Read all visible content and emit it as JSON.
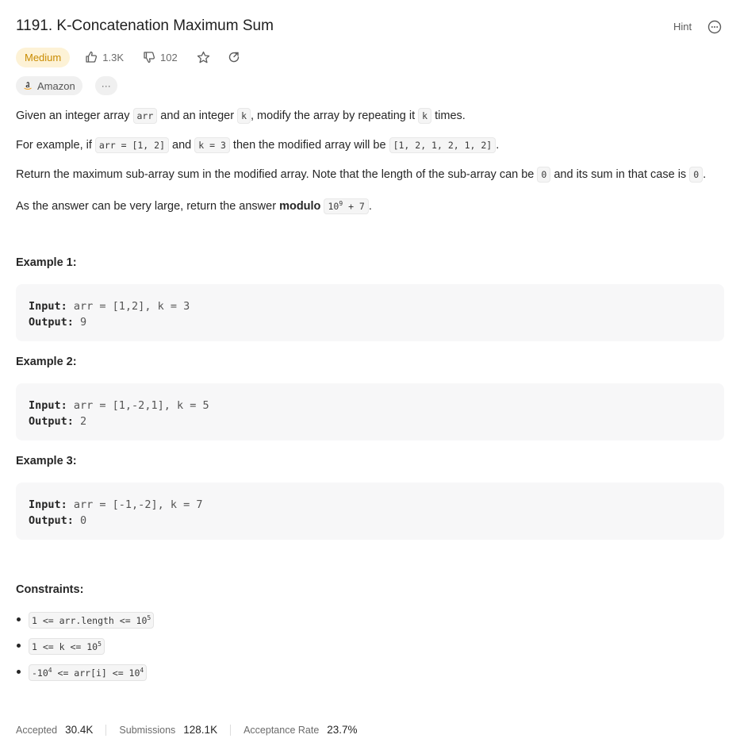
{
  "problem": {
    "title": "1191. K-Concatenation Maximum Sum",
    "hint_label": "Hint",
    "difficulty": "Medium",
    "likes": "1.3K",
    "dislikes": "102",
    "company_tag": "Amazon",
    "more_tags": "···"
  },
  "description": {
    "p1": {
      "t1": "Given an integer array ",
      "c1": "arr",
      "t2": " and an integer ",
      "c2": "k",
      "t3": ", modify the array by repeating it ",
      "c3": "k",
      "t4": " times."
    },
    "p2": {
      "t1": "For example, if ",
      "c1": "arr = [1, 2]",
      "t2": " and ",
      "c2": "k = 3",
      "t3": " then the modified array will be ",
      "c3": "[1, 2, 1, 2, 1, 2]",
      "t4": "."
    },
    "p3": {
      "t1": "Return the maximum sub-array sum in the modified array. Note that the length of the sub-array can be ",
      "c1": "0",
      "t2": " and its sum in that case is ",
      "c2": "0",
      "t3": "."
    },
    "p4": {
      "t1": "As the answer can be very large, return the answer ",
      "bold": "modulo",
      "c_base": "10",
      "c_exp": "9",
      "c_rest": " + 7",
      "t2": "."
    }
  },
  "examples": [
    {
      "title": "Example 1:",
      "input_label": "Input:",
      "input": " arr = [1,2], k = 3",
      "output_label": "Output:",
      "output": " 9"
    },
    {
      "title": "Example 2:",
      "input_label": "Input:",
      "input": " arr = [1,-2,1], k = 5",
      "output_label": "Output:",
      "output": " 2"
    },
    {
      "title": "Example 3:",
      "input_label": "Input:",
      "input": " arr = [-1,-2], k = 7",
      "output_label": "Output:",
      "output": " 0"
    }
  ],
  "constraints": {
    "title": "Constraints:",
    "c1": {
      "pre": "1 <= arr.length <= 10",
      "exp": "5"
    },
    "c2": {
      "pre": "1 <= k <= 10",
      "exp": "5"
    },
    "c3": {
      "pre": "-10",
      "exp1": "4",
      "mid": " <= arr[i] <= 10",
      "exp2": "4"
    }
  },
  "stats": {
    "accepted_label": "Accepted",
    "accepted": "30.4K",
    "submissions_label": "Submissions",
    "submissions": "128.1K",
    "rate_label": "Acceptance Rate",
    "rate": "23.7%"
  },
  "icons": [
    "thumbs-up-icon",
    "thumbs-down-icon",
    "star-icon",
    "share-icon",
    "more-icon",
    "amazon-logo"
  ],
  "colors": {
    "difficulty_bg": "#fdf2d6",
    "difficulty_text": "#c98b00"
  }
}
